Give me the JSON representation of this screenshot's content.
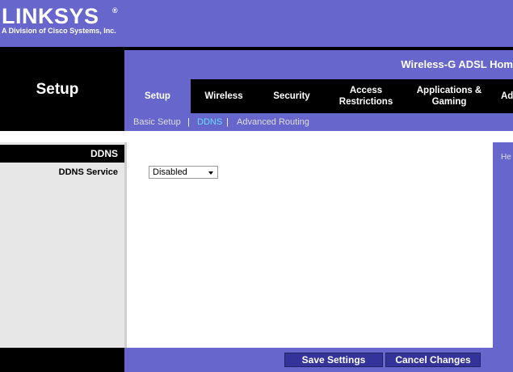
{
  "brand": {
    "logo_text": "LINKSYS",
    "registered_mark": "®",
    "tagline": "A Division of Cisco Systems, Inc."
  },
  "section_title": "Setup",
  "product_name": "Wireless-G ADSL Hom",
  "tabs": [
    {
      "label": "Setup",
      "active": true
    },
    {
      "label": "Wireless"
    },
    {
      "label": "Security"
    },
    {
      "label": "Access\nRestrictions"
    },
    {
      "label": "Applications &\nGaming"
    },
    {
      "label": "Ad"
    }
  ],
  "subnav": {
    "items": [
      {
        "label": "Basic Setup"
      },
      {
        "label": "DDNS",
        "active": true
      },
      {
        "label": "Advanced Routing"
      }
    ],
    "separator": "|"
  },
  "left": {
    "group_header": "DDNS",
    "ddns_service_label": "DDNS Service"
  },
  "form": {
    "ddns_service_value": "Disabled"
  },
  "help": {
    "label": "He"
  },
  "buttons": {
    "save": "Save Settings",
    "cancel": "Cancel Changes"
  },
  "colors": {
    "brand_purple": "#6666cc",
    "black": "#000000",
    "active_subnav": "#66ddff"
  }
}
